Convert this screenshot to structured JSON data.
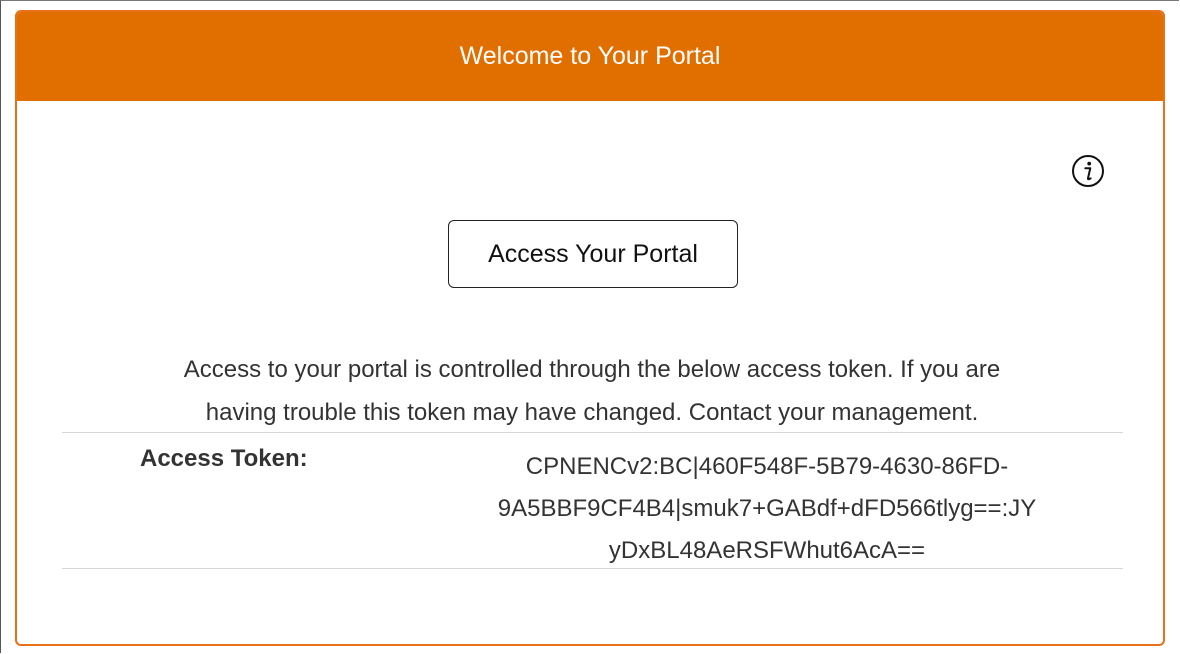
{
  "header": {
    "title": "Welcome to Your Portal"
  },
  "info": {
    "icon": "info-icon"
  },
  "actions": {
    "access_portal_label": "Access Your Portal"
  },
  "description": {
    "line1": "Access to your portal is controlled through the below access token. If you are",
    "line2": "having trouble this token may have changed. Contact your management."
  },
  "token": {
    "label": "Access Token:",
    "line1": "CPNENCv2:BC|460F548F-5B79-4630-86FD-",
    "line2": "9A5BBF9CF4B4|smuk7+GABdf+dFD566tlyg==:JY",
    "line3": "yDxBL48AeRSFWhut6AcA=="
  },
  "colors": {
    "header_bg": "#e06f00",
    "card_border": "#e8701a",
    "text": "#333333"
  }
}
